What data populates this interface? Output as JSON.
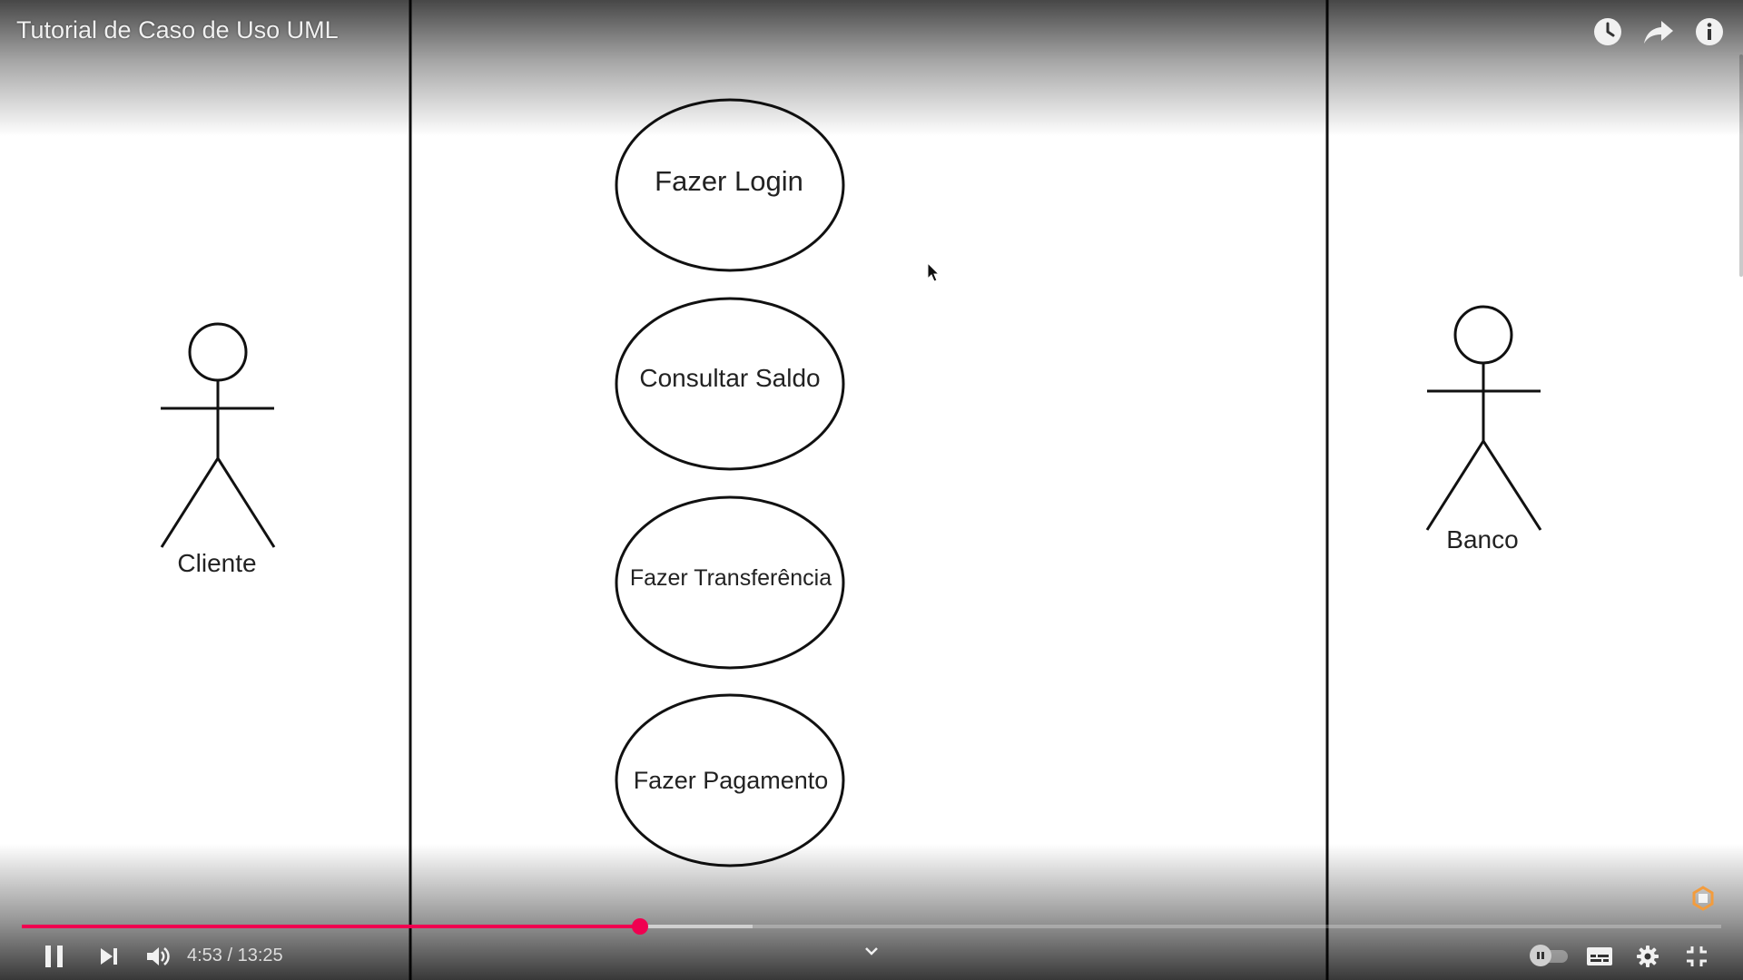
{
  "video": {
    "title": "Tutorial de Caso de Uso UML",
    "current_time": "4:53",
    "duration": "13:25",
    "played_fraction": 0.364,
    "buffered_fraction": 0.43
  },
  "diagram": {
    "actors": [
      {
        "label": "Cliente"
      },
      {
        "label": "Banco"
      }
    ],
    "use_cases": [
      {
        "label": "Fazer Login"
      },
      {
        "label": "Consultar Saldo"
      },
      {
        "label": "Fazer Transferência"
      },
      {
        "label": "Fazer Pagamento"
      }
    ]
  },
  "controls": {
    "time_separator": " / ",
    "icons": {
      "watch_later": "clock-icon",
      "share": "share-icon",
      "info": "info-icon",
      "play_pause": "pause-icon",
      "next": "next-icon",
      "volume": "volume-icon",
      "chapters": "chevron-down-icon",
      "autoplay": "autoplay-toggle",
      "captions": "subtitles-icon",
      "settings": "gear-icon",
      "fullscreen": "exit-fullscreen-icon"
    }
  },
  "colors": {
    "progress_played": "#f00050",
    "brand_logo": "#f39c3d"
  }
}
